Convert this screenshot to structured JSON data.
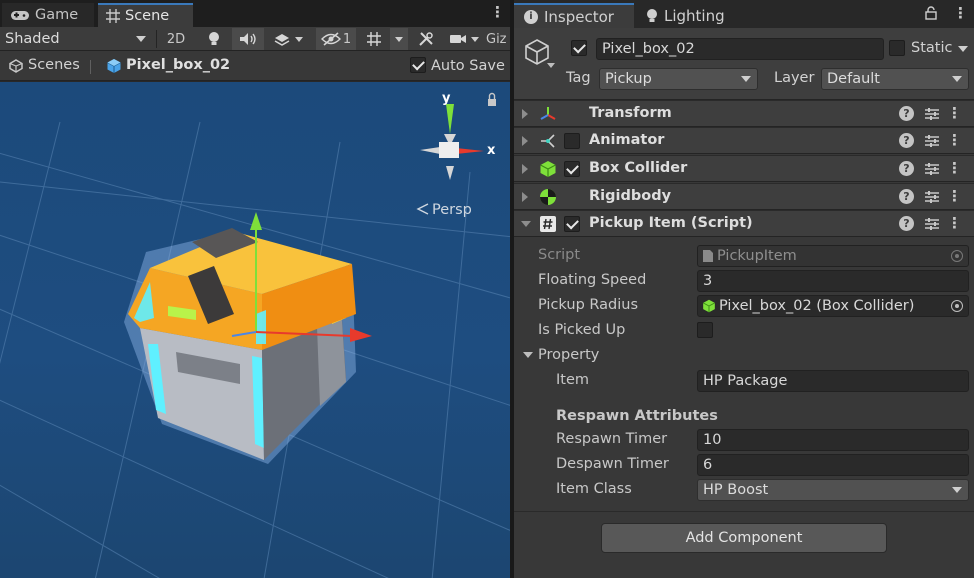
{
  "scene_panel": {
    "tabs": [
      {
        "label": "Game",
        "icon": "gamepad-icon"
      },
      {
        "label": "Scene",
        "icon": "grid-icon"
      }
    ],
    "toolbar": {
      "shading_mode": "Shaded",
      "mode_2d": "2D",
      "hidden_count": "1",
      "gizmos": "Giz"
    },
    "breadcrumb": {
      "root": "Scenes",
      "object": "Pixel_box_02",
      "auto_save_label": "Auto Save",
      "auto_save_checked": true
    },
    "viewport": {
      "projection_label": "Persp",
      "axis_labels": {
        "y": "y",
        "x": "x"
      },
      "colors": {
        "sky_top": "#1c4a7b",
        "chest_orange": "#f5a623",
        "chest_gray": "#b8bcc4",
        "glow_cyan": "#5ff0ff",
        "axis_x": "#e83a2c",
        "axis_y": "#7ee03a"
      }
    }
  },
  "inspector": {
    "tabs": [
      {
        "label": "Inspector",
        "icon": "info-icon"
      },
      {
        "label": "Lighting",
        "icon": "light-bulb-icon"
      }
    ],
    "gameobject": {
      "active": true,
      "name": "Pixel_box_02",
      "static_label": "Static",
      "static_checked": false,
      "tag_label": "Tag",
      "tag_value": "Pickup",
      "layer_label": "Layer",
      "layer_value": "Default"
    },
    "components": [
      {
        "name": "Transform",
        "has_checkbox": false,
        "enabled": true,
        "icon": "transform-icon"
      },
      {
        "name": "Animator",
        "has_checkbox": true,
        "enabled": false,
        "icon": "animator-icon"
      },
      {
        "name": "Box Collider",
        "has_checkbox": true,
        "enabled": true,
        "icon": "box-collider-icon"
      },
      {
        "name": "Rigidbody",
        "has_checkbox": false,
        "enabled": true,
        "icon": "rigidbody-icon"
      },
      {
        "name": "Pickup Item (Script)",
        "has_checkbox": true,
        "enabled": true,
        "icon": "script-icon"
      }
    ],
    "script_fields": {
      "script_label": "Script",
      "script_value": "PickupItem",
      "floating_speed_label": "Floating Speed",
      "floating_speed_value": "3",
      "pickup_radius_label": "Pickup Radius",
      "pickup_radius_value": "Pixel_box_02 (Box Collider)",
      "is_picked_up_label": "Is Picked Up",
      "is_picked_up_checked": false,
      "property_label": "Property",
      "item_label": "Item",
      "item_value": "HP Package",
      "respawn_header": "Respawn Attributes",
      "respawn_timer_label": "Respawn Timer",
      "respawn_timer_value": "10",
      "despawn_timer_label": "Despawn Timer",
      "despawn_timer_value": "6",
      "item_class_label": "Item Class",
      "item_class_value": "HP Boost"
    },
    "add_component_label": "Add Component",
    "help_glyph": "?"
  }
}
